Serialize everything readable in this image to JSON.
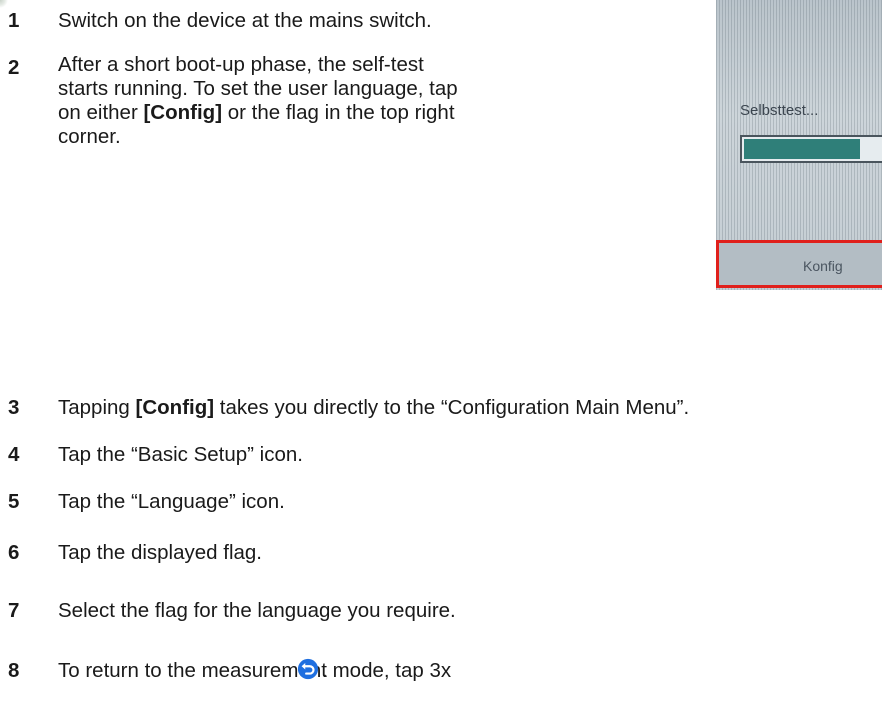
{
  "steps": [
    {
      "num": "1",
      "text": "Switch on the device at the mains switch."
    },
    {
      "num": "2",
      "lines": [
        "After a short boot-up phase, the self-test",
        "starts running. To set the user language, tap"
      ],
      "line3_pre": "on either ",
      "line3_bold": "[Config]",
      "line3_post": " or the flag in the top right",
      "line4": "corner."
    },
    {
      "num": "3",
      "pre": "Tapping ",
      "bold": "[Config]",
      "post": " takes you directly to the “Configuration Main Menu”."
    },
    {
      "num": "4",
      "text": "Tap the “Basic Setup” icon."
    },
    {
      "num": "5",
      "text": "Tap the “Language” icon."
    },
    {
      "num": "6",
      "text": "Tap the displayed flag."
    },
    {
      "num": "7",
      "text": "Select the flag for the language you require."
    },
    {
      "num": "8",
      "text": "To return to the measurement mode, tap 3x",
      "end": "."
    }
  ],
  "device_screen": {
    "selftest_label": "Selbsttest...",
    "progress": 0.82,
    "konfig_label": "Konfig"
  },
  "colors": {
    "highlight": "#e0201c",
    "progress_fill": "#2f7f79",
    "back_icon": "#1f6fe0"
  },
  "icons": {
    "back": "back-arrow-icon"
  }
}
